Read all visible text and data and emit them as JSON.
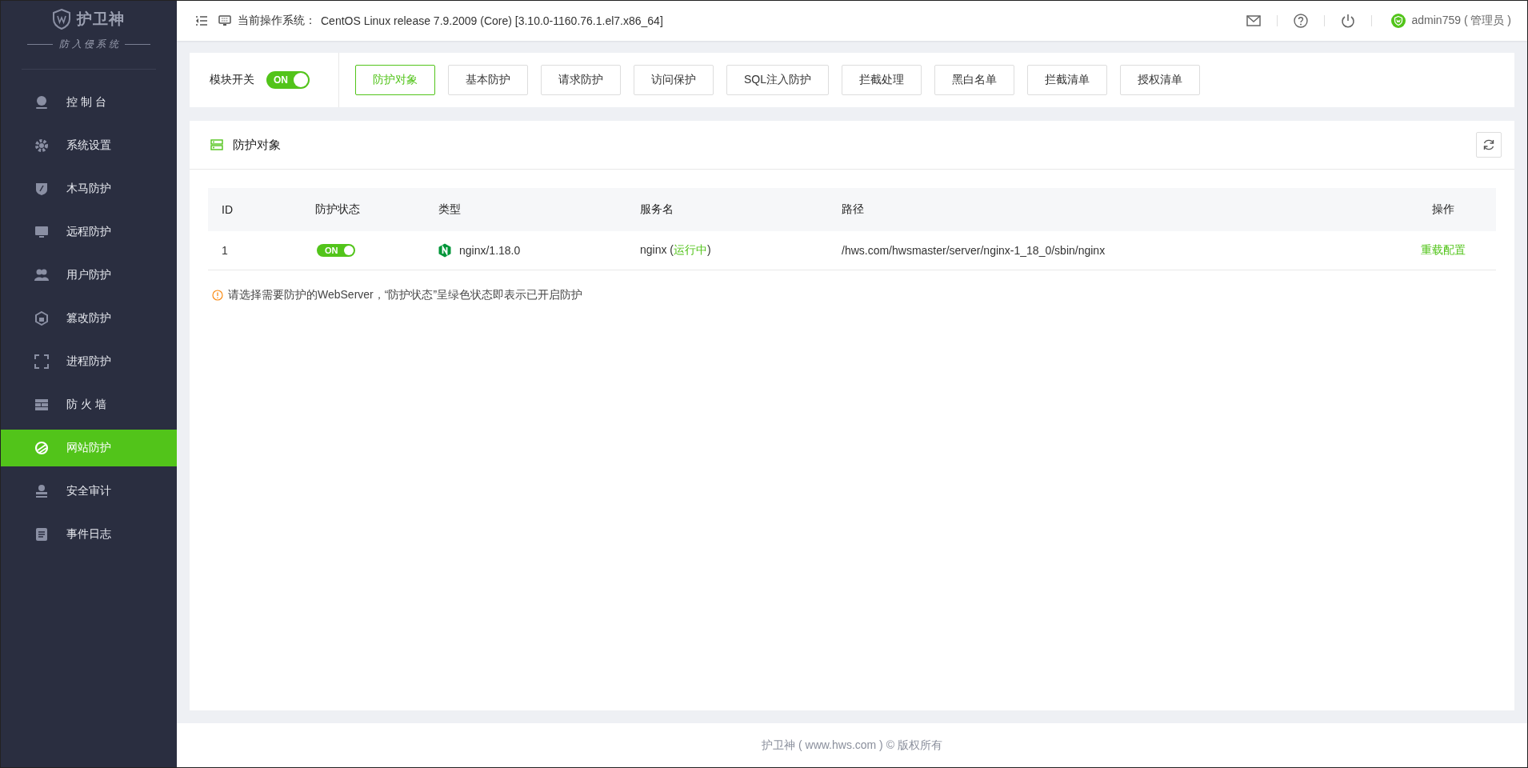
{
  "sidebar": {
    "logo": {
      "title": "护卫神",
      "subtitle": "防 入 侵 系 统"
    },
    "items": [
      {
        "label": "控 制 台",
        "selected": false
      },
      {
        "label": "系统设置",
        "selected": false
      },
      {
        "label": "木马防护",
        "selected": false
      },
      {
        "label": "远程防护",
        "selected": false
      },
      {
        "label": "用户防护",
        "selected": false
      },
      {
        "label": "篡改防护",
        "selected": false
      },
      {
        "label": "进程防护",
        "selected": false
      },
      {
        "label": "防 火 墙",
        "selected": false
      },
      {
        "label": "网站防护",
        "selected": true
      },
      {
        "label": "安全审计",
        "selected": false
      },
      {
        "label": "事件日志",
        "selected": false
      }
    ]
  },
  "header": {
    "os_label": "当前操作系统：",
    "os_value": "CentOS Linux release 7.9.2009 (Core) [3.10.0-1160.76.1.el7.x86_64]",
    "user": "admin759 ( 管理员 )"
  },
  "module_switch": {
    "label": "模块开关",
    "on": true,
    "text": "ON"
  },
  "tabs": [
    {
      "label": "防护对象",
      "selected": true
    },
    {
      "label": "基本防护",
      "selected": false
    },
    {
      "label": "请求防护",
      "selected": false
    },
    {
      "label": "访问保护",
      "selected": false
    },
    {
      "label": "SQL注入防护",
      "selected": false
    },
    {
      "label": "拦截处理",
      "selected": false
    },
    {
      "label": "黑白名单",
      "selected": false
    },
    {
      "label": "拦截清单",
      "selected": false
    },
    {
      "label": "授权清单",
      "selected": false
    }
  ],
  "panel": {
    "title": "防护对象",
    "table": {
      "columns": [
        "ID",
        "防护状态",
        "类型",
        "服务名",
        "路径",
        "操作"
      ],
      "rows": [
        {
          "id": "1",
          "protection": {
            "on": true,
            "text": "ON"
          },
          "type": "nginx/1.18.0",
          "service": {
            "before": "nginx (",
            "status": "运行中",
            "after": ")"
          },
          "path": "/hws.com/hwsmaster/server/nginx-1_18_0/sbin/nginx",
          "action": "重载配置"
        }
      ]
    },
    "note": "请选择需要防护的WebServer，“防护状态”呈绿色状态即表示已开启防护"
  },
  "footer": "护卫神 ( www.hws.com ) © 版权所有"
}
